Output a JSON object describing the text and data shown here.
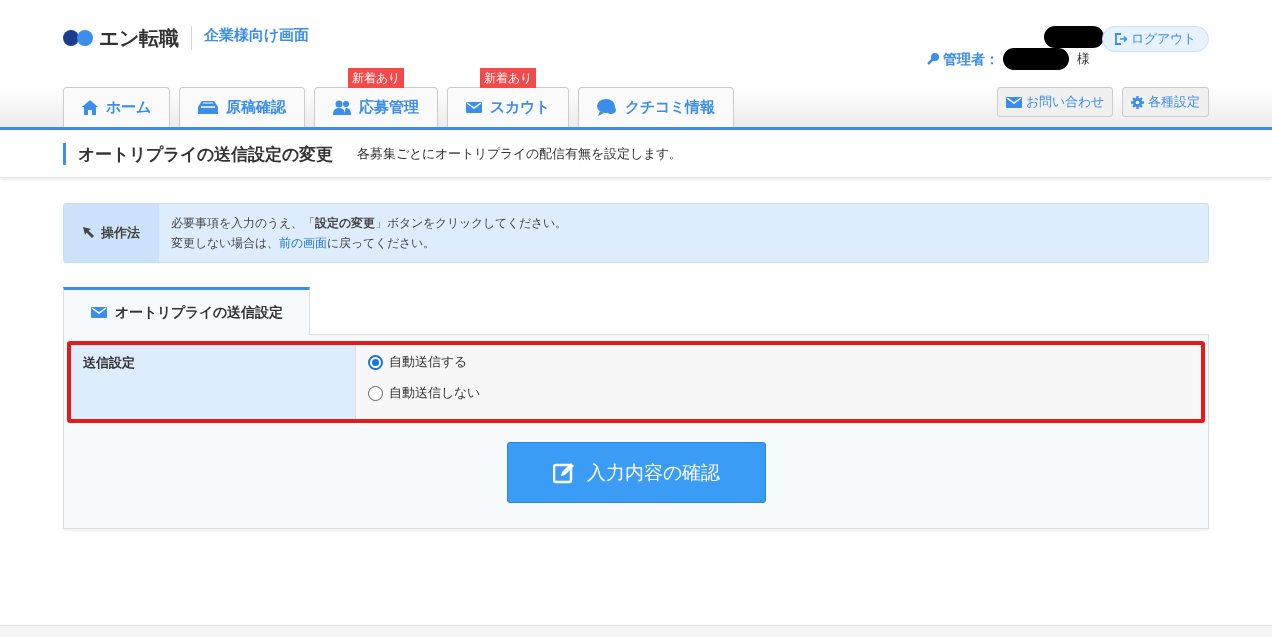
{
  "header": {
    "logo": "エン転職",
    "subtitle": "企業様向け画面",
    "admin_label": "管理者：",
    "honorific": "様",
    "logout": "ログアウト"
  },
  "nav": {
    "tabs": [
      {
        "label": "ホーム"
      },
      {
        "label": "原稿確認"
      },
      {
        "label": "応募管理",
        "badge": "新着あり"
      },
      {
        "label": "スカウト",
        "badge": "新着あり"
      },
      {
        "label": "クチコミ情報"
      }
    ],
    "buttons": [
      {
        "label": "お問い合わせ"
      },
      {
        "label": "各種設定"
      }
    ]
  },
  "page_title": "オートリプライの送信設定の変更",
  "page_description": "各募集ごとにオートリプライの配信有無を設定します。",
  "instructions": {
    "label": "操作法",
    "line1": "必要事項を入力のうえ、「**設定の変更**」ボタンをクリックしてください。",
    "line2_before": "変更しない場合は、",
    "line2_link": "前の画面",
    "line2_after": "に戻ってください。"
  },
  "form_tab": {
    "label": "オートリプライの送信設定"
  },
  "setting": {
    "label": "送信設定",
    "options": [
      {
        "label": "自動送信する",
        "selected": true
      },
      {
        "label": "自動送信しない",
        "selected": false
      }
    ]
  },
  "confirm_button": "入力内容の確認"
}
